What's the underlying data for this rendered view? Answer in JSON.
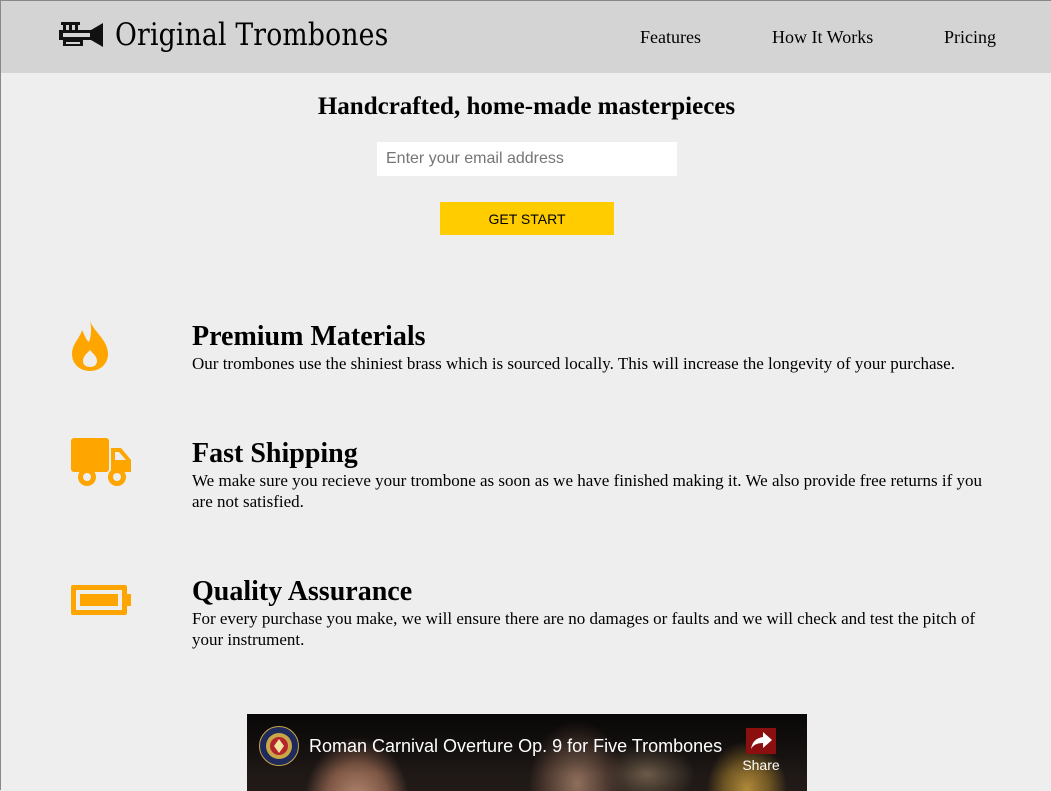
{
  "brand": {
    "name": "Original Trombones",
    "logo_icon": "trumpet-icon"
  },
  "nav": {
    "features": "Features",
    "how_it_works": "How It Works",
    "pricing": "Pricing"
  },
  "hero": {
    "title": "Handcrafted, home-made masterpieces",
    "email_placeholder": "Enter your email address",
    "email_value": "",
    "button_label": "GET START"
  },
  "features": [
    {
      "icon": "fire-icon",
      "title": "Premium Materials",
      "description": "Our trombones use the shiniest brass which is sourced locally. This will increase the longevity of your purchase."
    },
    {
      "icon": "truck-icon",
      "title": "Fast Shipping",
      "description": "We make sure you recieve your trombone as soon as we have finished making it. We also provide free returns if you are not satisfied."
    },
    {
      "icon": "battery-icon",
      "title": "Quality Assurance",
      "description": "For every purchase you make, we will ensure there are no damages or faults and we will check and test the pitch of your instrument."
    }
  ],
  "video": {
    "title": "Roman Carnival Overture Op. 9 for Five Trombones",
    "share_label": "Share"
  },
  "colors": {
    "header_bg": "#d4d4d4",
    "page_bg": "#eeeeee",
    "accent": "#ffa500",
    "button": "#ffcc00"
  }
}
